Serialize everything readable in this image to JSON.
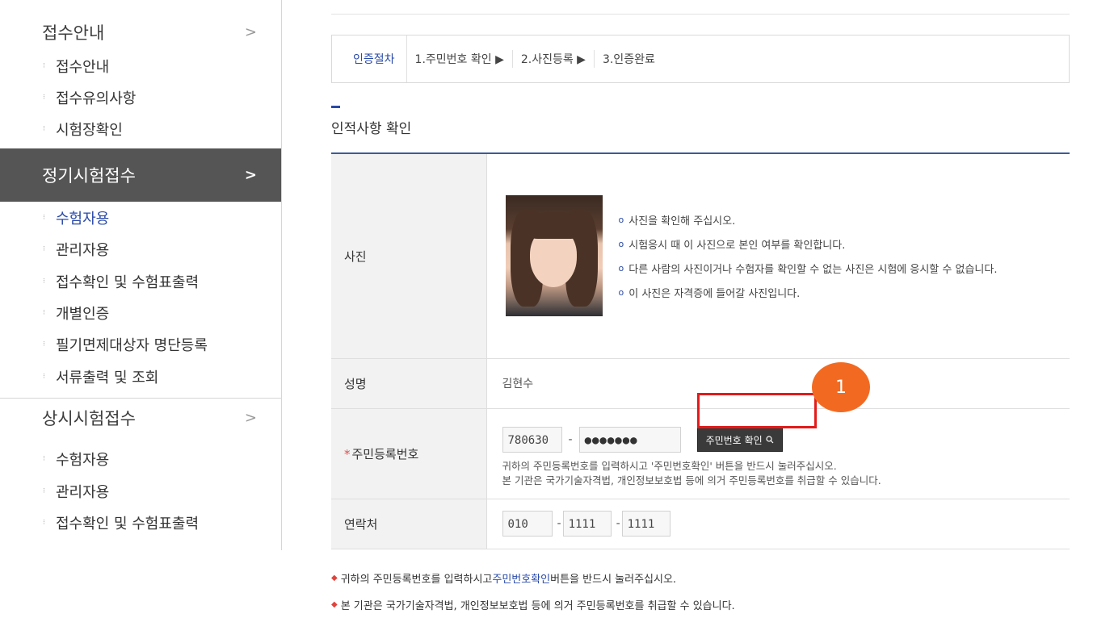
{
  "sidebar": {
    "sections": [
      {
        "title": "접수안내",
        "chevron": ">",
        "active": false,
        "items": [
          "접수안내",
          "접수유의사항",
          "시험장확인"
        ]
      },
      {
        "title": "정기시험접수",
        "chevron": ">",
        "active": true,
        "items": [
          "수험자용",
          "관리자용",
          "접수확인 및 수험표출력",
          "개별인증",
          "필기면제대상자 명단등록",
          "서류출력 및 조회"
        ]
      },
      {
        "title": "상시시험접수",
        "chevron": ">",
        "active": false,
        "items": [
          "수험자용",
          "관리자용",
          "접수확인 및 수험표출력"
        ]
      }
    ]
  },
  "steps": {
    "lead": "인증절차",
    "items": [
      "1.주민번호 확인 ▶",
      "2.사진등록 ▶",
      "3.인증완료"
    ]
  },
  "section_title": "인적사항 확인",
  "table": {
    "photo_label": "사진",
    "photo_notes": [
      "사진을 확인해 주십시오.",
      "시험응시 때 이 사진으로 본인 여부를 확인합니다.",
      "다른 사람의 사진이거나 수험자를 확인할 수 없는 사진은 시험에 응시할 수 없습니다.",
      "이 사진은 자격증에 들어갈 사진입니다."
    ],
    "name_label": "성명",
    "name_value": "김현수",
    "rrn_required": "*",
    "rrn_label": "주민등록번호",
    "rrn_front": "780630",
    "rrn_hyphen": "-",
    "rrn_back": "●●●●●●●",
    "rrn_button": "주민번호 확인",
    "rrn_help_1": "귀하의 주민등록번호를 입력하시고 '주민번호확인' 버튼을 반드시 눌러주십시오.",
    "rrn_help_2": "본 기관은 국가기술자격법, 개인정보보호법 등에 의거 주민등록번호를 취급할 수 있습니다.",
    "phone_label": "연락처",
    "phone_1": "010",
    "phone_2": "1111",
    "phone_3": "1111",
    "phone_hyphen": "-"
  },
  "annotation": {
    "badge": "1",
    "highlight_color": "#e31b1b",
    "badge_color": "#f26a22"
  },
  "notice": {
    "line1_pre": "귀하의 주민등록번호를 입력하시고 ",
    "line1_link": "주민번호확인",
    "line1_post": " 버튼을 반드시 눌러주십시오.",
    "line2": "본 기관은 국가기술자격법, 개인정보보호법 등에 의거 주민등록번호를 취급할 수 있습니다."
  }
}
